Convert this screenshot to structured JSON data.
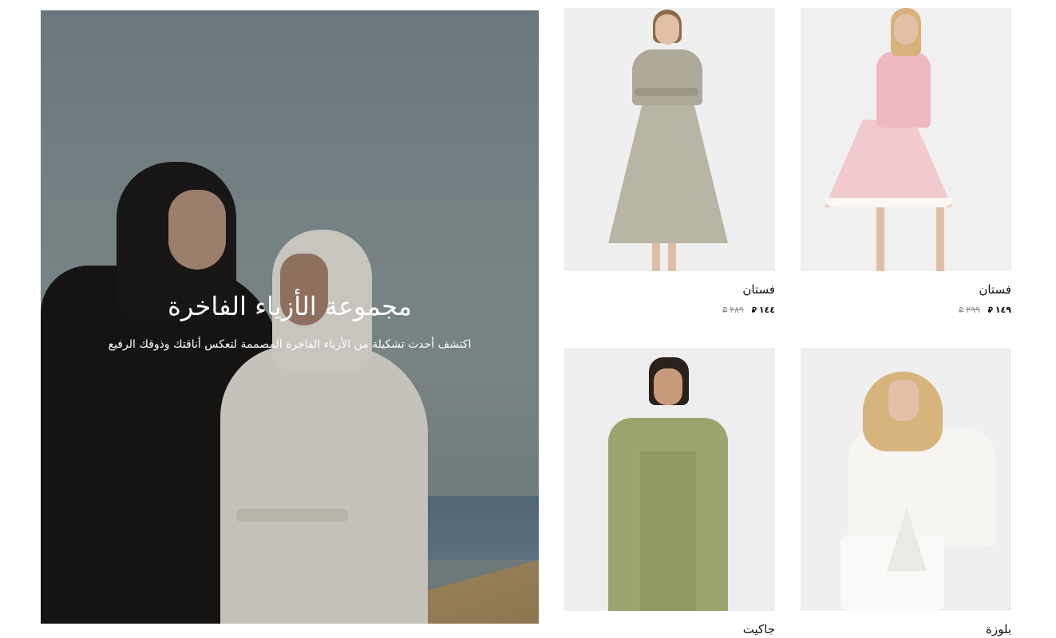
{
  "hero": {
    "title": "مجموعة الأزياء الفاخرة",
    "subtitle": "اكتشف أحدث تشكيلة من الأزياء الفاخرة المصممة لتعكس أناقتك وذوقك الرفيع"
  },
  "currency_symbol": "⃁",
  "products": [
    {
      "name": "فستان",
      "price": "١٤٩",
      "old_price": "٢٩٩",
      "image": "pink-floral-dress-image"
    },
    {
      "name": "فستان",
      "price": "١٤٤",
      "old_price": "٢٨٩",
      "image": "sage-belted-dress-image"
    },
    {
      "name": "بلوزة",
      "price": "",
      "old_price": "",
      "image": "white-eyelet-blouse-image"
    },
    {
      "name": "جاكيت",
      "price": "",
      "old_price": "",
      "image": "green-paisley-jacket-image"
    }
  ],
  "colors": {
    "hero_sky": "#8a999c",
    "price_text": "#111111",
    "old_price_text": "#8a8a8a",
    "card_background": "#eeeeee"
  }
}
